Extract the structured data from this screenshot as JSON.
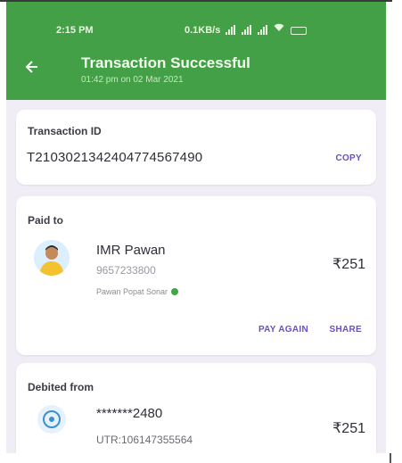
{
  "status_bar": {
    "time": "2:15 PM",
    "network_speed": "0.1KB/s"
  },
  "app_bar": {
    "title": "Transaction Successful",
    "subtitle": "01:42 pm on 02 Mar 2021"
  },
  "transaction": {
    "label": "Transaction ID",
    "id": "T2103021342404774567490",
    "copy_label": "COPY"
  },
  "paid_to": {
    "label": "Paid to",
    "name": "IMR Pawan",
    "phone": "9657233800",
    "registered_name": "Pawan Popat Sonar",
    "amount": "₹251",
    "pay_again_label": "PAY AGAIN",
    "share_label": "SHARE"
  },
  "debited_from": {
    "label": "Debited from",
    "account": "*******2480",
    "utr": "UTR:106147355564",
    "amount": "₹251"
  },
  "colors": {
    "header_green": "#43a047",
    "accent_purple": "#6c4ec4",
    "verified_green": "#3fa745",
    "background": "#f1edf6"
  }
}
